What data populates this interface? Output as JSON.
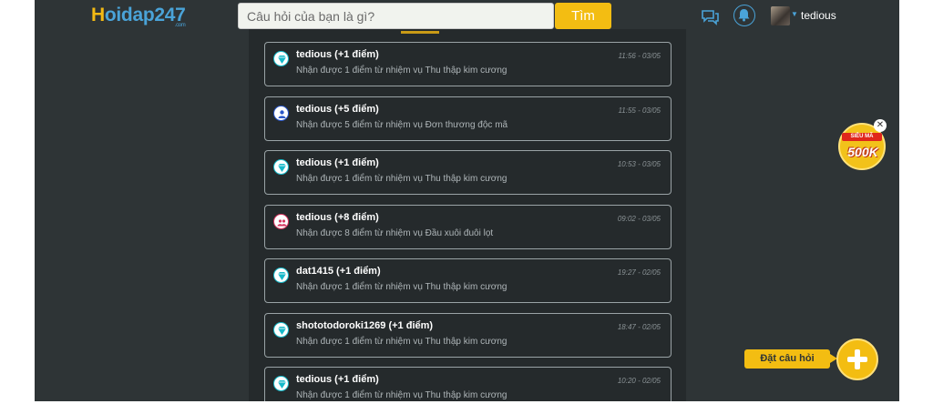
{
  "header": {
    "logo_prefix": "H",
    "logo_text": "oidap247",
    "logo_suffix": ".com",
    "search_placeholder": "Câu hỏi của bạn là gì?",
    "search_button": "Tìm",
    "username": "tedious"
  },
  "notifications": [
    {
      "title": "tedious (+1 điểm)",
      "desc": "Nhận được 1 điểm từ nhiệm vụ Thu thập kim cương",
      "time": "11:56 - 03/05",
      "icon": "diamond-icon",
      "color": "#16b9c9"
    },
    {
      "title": "tedious (+5 điểm)",
      "desc": "Nhận được 5 điểm từ nhiệm vụ Đơn thương độc mã",
      "time": "11:55 - 03/05",
      "icon": "user-badge-icon",
      "color": "#2a57c9"
    },
    {
      "title": "tedious (+1 điểm)",
      "desc": "Nhận được 1 điểm từ nhiệm vụ Thu thập kim cương",
      "time": "10:53 - 03/05",
      "icon": "diamond-icon",
      "color": "#16b9c9"
    },
    {
      "title": "tedious (+8 điểm)",
      "desc": "Nhận được 8 điểm từ nhiệm vụ Đầu xuôi đuôi lọt",
      "time": "09:02 - 03/05",
      "icon": "group-icon",
      "color": "#d5345f"
    },
    {
      "title": "dat1415 (+1 điểm)",
      "desc": "Nhận được 1 điểm từ nhiệm vụ Thu thập kim cương",
      "time": "19:27 - 02/05",
      "icon": "diamond-icon",
      "color": "#16b9c9"
    },
    {
      "title": "shototodoroki1269 (+1 điểm)",
      "desc": "Nhận được 1 điểm từ nhiệm vụ Thu thập kim cương",
      "time": "18:47 - 02/05",
      "icon": "diamond-icon",
      "color": "#16b9c9"
    },
    {
      "title": "tedious (+1 điểm)",
      "desc": "Nhận được 1 điểm từ nhiệm vụ Thu thập kim cương",
      "time": "10:20 - 02/05",
      "icon": "diamond-icon",
      "color": "#16b9c9"
    }
  ],
  "promo": {
    "line1": "SIÊU MÃ",
    "line2": "500K"
  },
  "ask_label": "Đặt câu hỏi",
  "colors": {
    "accent": "#f3bd12",
    "background": "#2e3436",
    "panel": "#252a2c",
    "link": "#4aa3d8"
  }
}
